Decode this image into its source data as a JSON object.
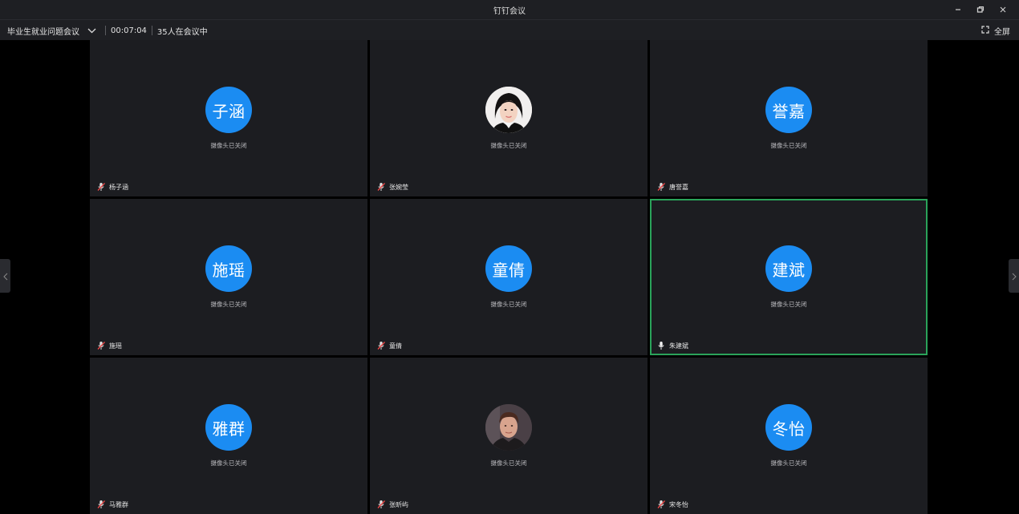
{
  "window": {
    "title": "钉钉会议",
    "minimize_icon": "minimize-icon",
    "restore_icon": "restore-icon",
    "close_icon": "close-icon"
  },
  "meeting": {
    "name": "毕业生就业问题会议",
    "duration": "00:07:04",
    "participants": "35人在会议中",
    "fullscreen_label": "全屏"
  },
  "colors": {
    "avatar_bg": "#1b8cf2",
    "active_border": "#2aa35a",
    "tile_bg": "#1c1d21",
    "bar_bg": "#1e1f23"
  },
  "tiles": [
    {
      "avatar_text": "子涵",
      "camera_status": "摄像头已关闭",
      "name": "杨子涵",
      "mic": "muted"
    },
    {
      "avatar_text": "",
      "avatar_image": "woman-portrait-photo",
      "camera_status": "摄像头已关闭",
      "name": "张婉莹",
      "mic": "muted"
    },
    {
      "avatar_text": "誉嘉",
      "camera_status": "摄像头已关闭",
      "name": "唐誉嘉",
      "mic": "muted"
    },
    {
      "avatar_text": "施瑶",
      "camera_status": "摄像头已关闭",
      "name": "施瑶",
      "mic": "muted"
    },
    {
      "avatar_text": "童倩",
      "camera_status": "摄像头已关闭",
      "name": "童倩",
      "mic": "muted"
    },
    {
      "avatar_text": "建斌",
      "camera_status": "摄像头已关闭",
      "name": "朱建斌",
      "mic": "on",
      "active": true
    },
    {
      "avatar_text": "雅群",
      "camera_status": "摄像头已关闭",
      "name": "马雅群",
      "mic": "muted"
    },
    {
      "avatar_text": "",
      "avatar_image": "man-portrait-photo",
      "camera_status": "摄像头已关闭",
      "name": "张昕屿",
      "mic": "muted"
    },
    {
      "avatar_text": "冬怡",
      "camera_status": "摄像头已关闭",
      "name": "宋冬怡",
      "mic": "muted"
    }
  ]
}
